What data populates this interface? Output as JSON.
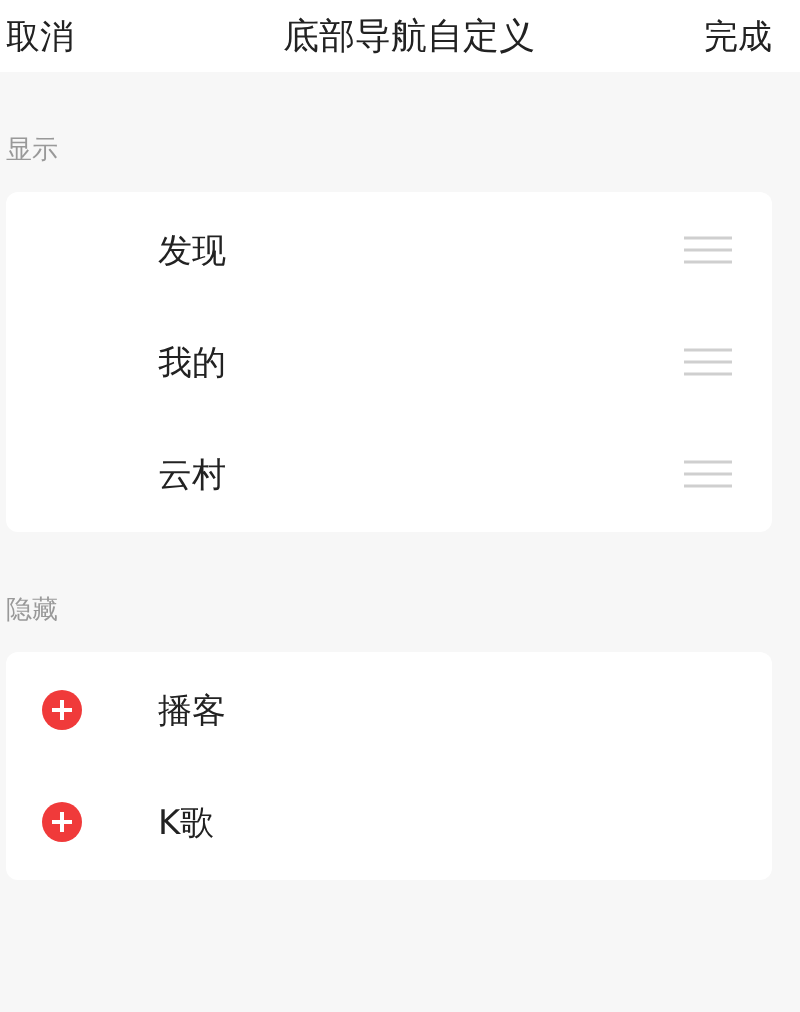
{
  "header": {
    "cancel": "取消",
    "title": "底部导航自定义",
    "done": "完成"
  },
  "sections": [
    {
      "label": "显示",
      "kind": "shown",
      "items": [
        {
          "label": "发现"
        },
        {
          "label": "我的"
        },
        {
          "label": "云村"
        }
      ]
    },
    {
      "label": "隐藏",
      "kind": "hidden",
      "items": [
        {
          "label": "播客"
        },
        {
          "label": "K歌"
        }
      ]
    }
  ]
}
